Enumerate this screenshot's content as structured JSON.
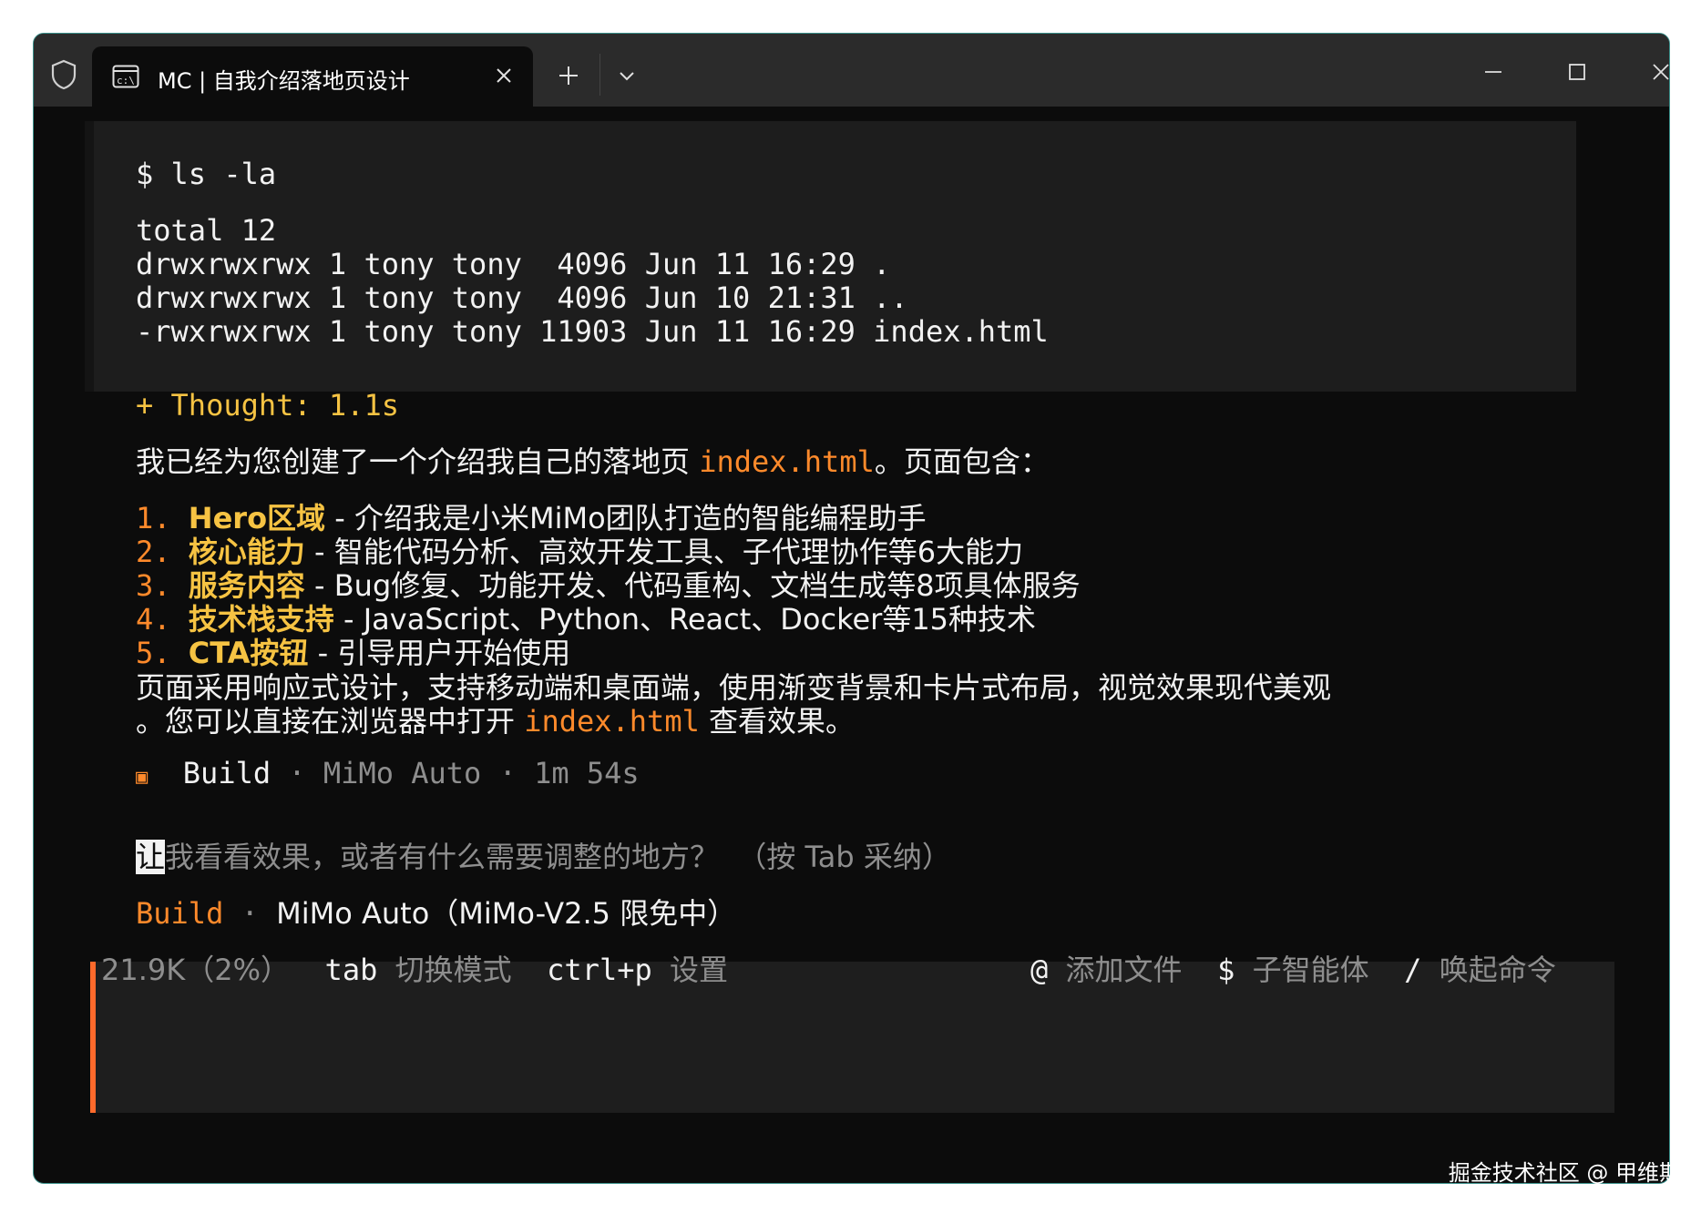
{
  "window": {
    "tab_title": "MC | 自我介绍落地页设计",
    "icons": {
      "shield": "shield-icon",
      "terminal": "terminal-icon",
      "close_tab": "close-icon",
      "new_tab": "plus-icon",
      "dropdown": "chevron-down-icon",
      "minimize": "minimize-icon",
      "maximize": "maximize-icon",
      "close_window": "close-icon"
    }
  },
  "terminal": {
    "command": "$ ls -la",
    "ls_output": [
      "total 12",
      "drwxrwxrwx 1 tony tony  4096 Jun 11 16:29 .",
      "drwxrwxrwx 1 tony tony  4096 Jun 10 21:31 ..",
      "-rwxrwxrwx 1 tony tony 11903 Jun 11 16:29 index.html"
    ],
    "thought": "+ Thought: 1.1s",
    "intro_before": "我已经为您创建了一个介绍我自己的落地页 ",
    "intro_file": "index.html",
    "intro_after": "。页面包含：",
    "items": [
      {
        "num": "1.",
        "title": "Hero区域",
        "desc": " - 介绍我是小米MiMo团队打造的智能编程助手"
      },
      {
        "num": "2.",
        "title": "核心能力",
        "desc": " - 智能代码分析、高效开发工具、子代理协作等6大能力"
      },
      {
        "num": "3.",
        "title": "服务内容",
        "desc": " - Bug修复、功能开发、代码重构、文档生成等8项具体服务"
      },
      {
        "num": "4.",
        "title": "技术栈支持",
        "desc": " - JavaScript、Python、React、Docker等15种技术"
      },
      {
        "num": "5.",
        "title": "CTA按钮",
        "desc": " - 引导用户开始使用"
      }
    ],
    "summary_line1": "页面采用响应式设计，支持移动端和桌面端，使用渐变背景和卡片式布局，视觉效果现代美观",
    "summary_line2_before": "。您可以直接在浏览器中打开 ",
    "summary_file": "index.html",
    "summary_line2_after": " 查看效果。",
    "status": {
      "marker": "▣",
      "mode": "Build",
      "sep1": " · ",
      "model": "MiMo Auto",
      "sep2": " · ",
      "duration": "1m 54s"
    }
  },
  "input": {
    "cursor_char": "让",
    "suggestion": "我看看效果，或者有什么需要调整的地方？  （按 Tab 采纳）",
    "mode": "Build",
    "sep": " · ",
    "model": "MiMo Auto（MiMo-V2.5 限免中）"
  },
  "footer": {
    "tokens": "21.9K（2%）",
    "tab_key": "tab",
    "tab_label": "切换模式",
    "ctrl_key": "ctrl+p",
    "ctrl_label": "设置",
    "at_key": "@",
    "at_label": "添加文件",
    "dollar_key": "$",
    "dollar_label": "子智能体",
    "slash_key": "/",
    "slash_label": "唤起命令"
  },
  "watermark": "掘金技术社区 @ 甲维斯",
  "colors": {
    "accent_orange": "#ff8a2b",
    "thought_yellow": "#f6c343",
    "input_border": "#ff6a2b",
    "window_border": "#3a8f8a"
  }
}
